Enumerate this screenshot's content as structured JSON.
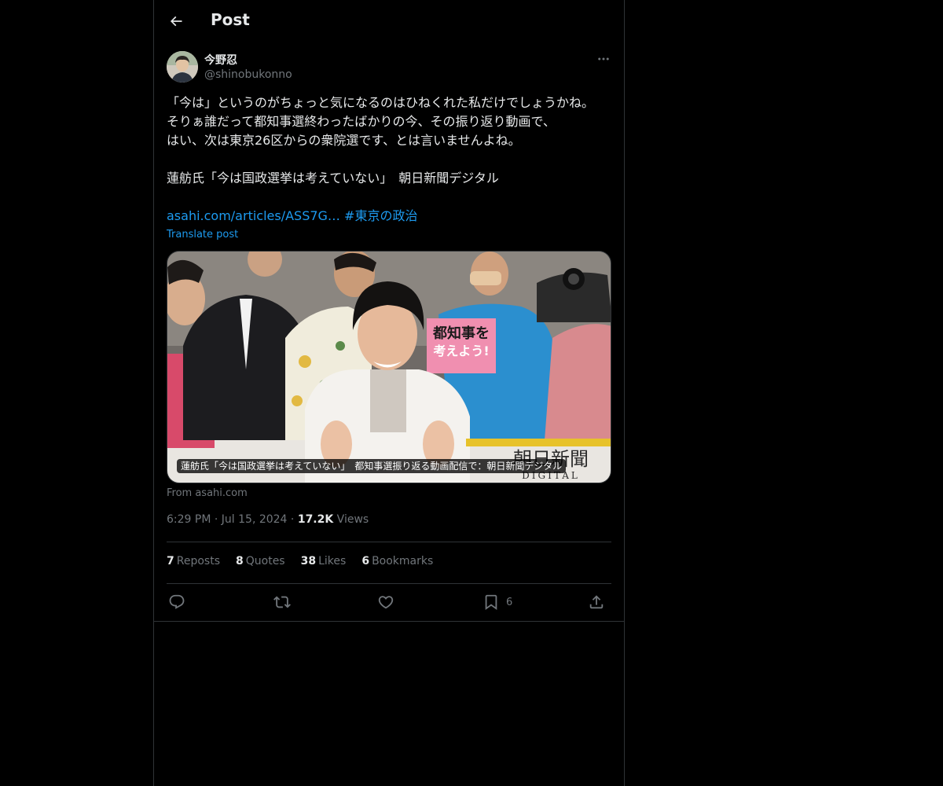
{
  "header": {
    "title": "Post",
    "back_icon": "arrow-left-icon"
  },
  "author": {
    "name": "今野忍",
    "handle": "@shinobukonno",
    "more_icon": "more-horizontal-icon"
  },
  "tweet": {
    "text": "「今は」というのがちょっと気になるのはひねくれた私だけでしょうかね。\nそりぁ誰だって都知事選終わったばかりの今、その振り返り動画で、\nはい、次は東京26区からの衆院選です、とは言いませんよね。\n\n蓮舫氏「今は国政選挙は考えていない」　朝日新聞デジタル",
    "link": "asahi.com/articles/ASS7G…",
    "hashtag": "#東京の政治",
    "translate": "Translate post"
  },
  "card": {
    "caption": "蓮舫氏「今は国政選挙は考えていない」　都知事選振り返る動画配信で：朝日新聞デジタル",
    "watermark_main": "朝日新聞",
    "watermark_sub": "DIGITAL",
    "sign_text_1": "都知事を",
    "sign_text_2": "考えよう!",
    "source": "From asahi.com"
  },
  "meta": {
    "time": "6:29 PM",
    "date": "Jul 15, 2024",
    "views_count": "17.2K",
    "views_label": "Views",
    "separator": "·"
  },
  "stats": {
    "reposts": {
      "count": "7",
      "label": "Reposts"
    },
    "quotes": {
      "count": "8",
      "label": "Quotes"
    },
    "likes": {
      "count": "38",
      "label": "Likes"
    },
    "bookmarks": {
      "count": "6",
      "label": "Bookmarks"
    }
  },
  "actions": {
    "reply_icon": "reply-icon",
    "repost_icon": "repost-icon",
    "like_icon": "heart-icon",
    "bookmark_icon": "bookmark-icon",
    "bookmark_count": "6",
    "share_icon": "share-icon"
  },
  "colors": {
    "background": "#000000",
    "text": "#e7e9ea",
    "muted": "#71767b",
    "accent": "#1d9bf0",
    "border": "#2f3336"
  }
}
